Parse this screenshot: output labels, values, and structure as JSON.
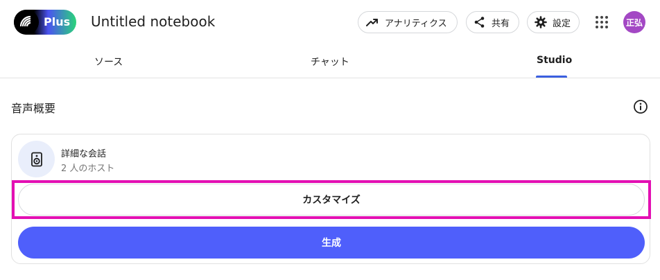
{
  "header": {
    "logo_label": "Plus",
    "notebook_title": "Untitled notebook",
    "analytics_label": "アナリティクス",
    "share_label": "共有",
    "settings_label": "設定",
    "avatar_initials": "正弘",
    "avatar_color": "#a348c4"
  },
  "tabs": [
    {
      "label": "ソース",
      "active": false
    },
    {
      "label": "チャット",
      "active": false
    },
    {
      "label": "Studio",
      "active": true
    }
  ],
  "studio": {
    "section_title": "音声概要",
    "card": {
      "icon": "speaker-icon",
      "title": "詳細な会話",
      "subtitle": "2 人のホスト",
      "customize_label": "カスタマイズ",
      "generate_label": "生成"
    }
  },
  "colors": {
    "accent": "#3b5fe0",
    "generate_button": "#4f5ffb",
    "highlight": "#e30fb3"
  }
}
